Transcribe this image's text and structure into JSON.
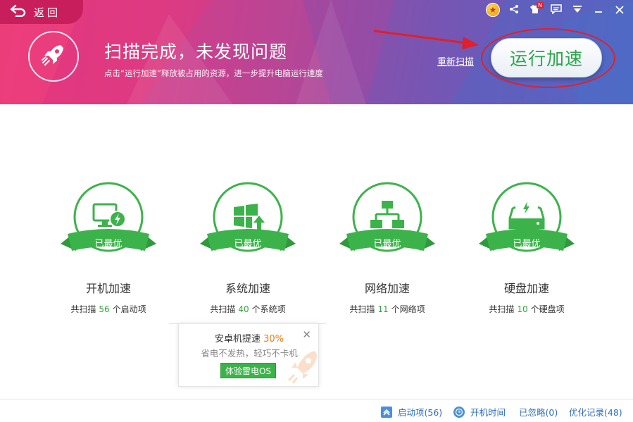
{
  "header": {
    "back_label": "返回",
    "title": "扫描完成，未发现问题",
    "subtitle": "点击“运行加速”释放被占用的资源，进一步提升电脑运行速度",
    "rescan_label": "重新扫描",
    "run_button_label": "运行加速",
    "notification_badge": "N"
  },
  "items": [
    {
      "icon": "monitor-lightning-icon",
      "status": "已最优",
      "name": "开机加速",
      "count_prefix": "共扫描",
      "count": "56",
      "count_suffix": "个启动项"
    },
    {
      "icon": "windows-upgrade-icon",
      "status": "已最优",
      "name": "系统加速",
      "count_prefix": "共扫描",
      "count": "40",
      "count_suffix": "个系统项"
    },
    {
      "icon": "network-icon",
      "status": "已最优",
      "name": "网络加速",
      "count_prefix": "共扫描",
      "count": "11",
      "count_suffix": "个网络项"
    },
    {
      "icon": "harddisk-icon",
      "status": "已最优",
      "name": "硬盘加速",
      "count_prefix": "共扫描",
      "count": "10",
      "count_suffix": "个硬盘项"
    }
  ],
  "popup": {
    "title": "安卓机提速",
    "percent": "30%",
    "subtitle": "省电不发热，轻巧不卡机",
    "button_label": "体验雷电OS"
  },
  "footer": {
    "startup": "启动项(56)",
    "boot_time": "开机时间",
    "ignored": "已忽略(0)",
    "history": "优化记录(48)"
  },
  "colors": {
    "accent_green": "#32a83b",
    "header_pink": "#e8357a",
    "header_blue": "#4f68c4",
    "annotation_red": "#e0202a",
    "link_blue": "#2e6fbf",
    "percent_orange": "#f07a12"
  }
}
